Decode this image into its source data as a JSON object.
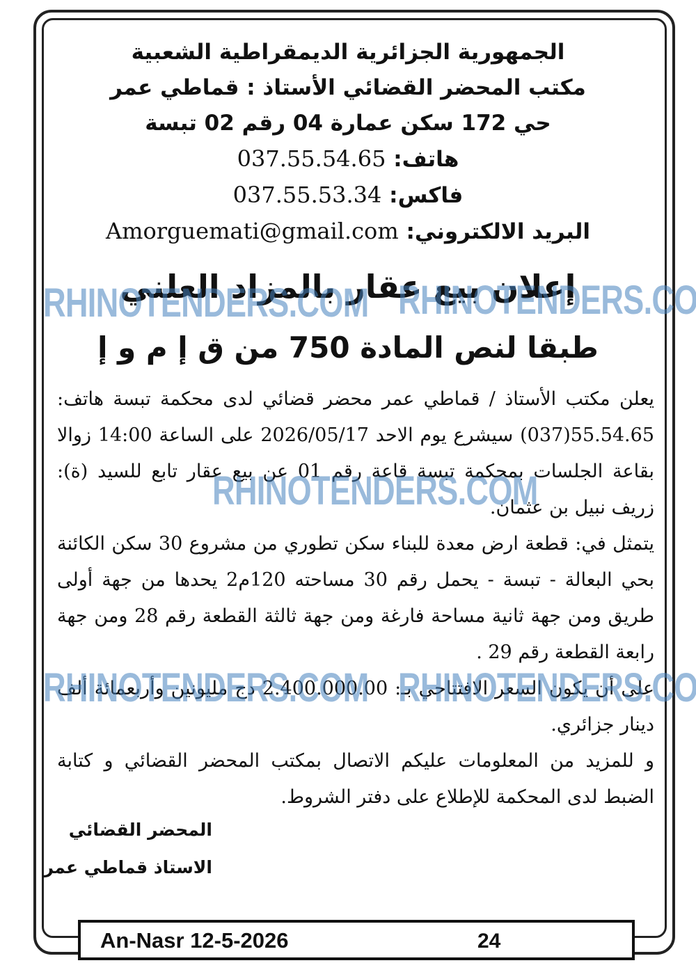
{
  "header": {
    "line1": "الجمهورية الجزائرية الديمقراطية الشعبية",
    "line2": "مكتب المحضر القضائي الأستاذ : قماطي عمر",
    "line3": "حي 172 سكن عمارة 04 رقم 02 تبسة",
    "phone_label": "هاتف:",
    "phone_value": "037.55.54.65",
    "fax_label": "فاكس:",
    "fax_value": "037.55.53.34",
    "email_label": "البريد الالكتروني:",
    "email_value": "Amorguemati@gmail.com"
  },
  "title": {
    "main": "إعلان بيع عقار بالمزاد العلني",
    "sub": "طبقا لنص المادة 750 من ق إ م و إ"
  },
  "body": {
    "p1": "يعلن مكتب الأستاذ / قماطي عمر محضر قضائي لدى محكمة تبسة هاتف: 55.54.65(037) سيشرع يوم الاحد 2026/05/17 على الساعة 14:00 زوالا بقاعة الجلسات بمحكمة تبسة قاعة رقم 01 عن بيع عقار تابع للسيد (ة): زريف نبيل بن عثمان.",
    "p2": "يتمثل في: قطعة ارض معدة للبناء سكن تطوري من مشروع 30 سكن الكائنة بحي البعالة - تبسة - يحمل رقم 30 مساحته 120م2 يحدها من جهة أولى طريق ومن جهة ثانية مساحة فارغة ومن جهة ثالثة القطعة رقم 28 ومن جهة رابعة القطعة رقم 29 .",
    "p3": "على أن يكون السعر الافتتاحي بـ: 2.400.000.00 دج مليونين وأربعمائة ألف دينار جزائري.",
    "p4": "و للمزيد من المعلومات عليكم الاتصال بمكتب المحضر القضائي و كتابة الضبط لدى المحكمة للإطلاع على دفتر الشروط."
  },
  "signature": {
    "line1": "المحضر القضائي",
    "line2": "الاستاذ قماطي عمر"
  },
  "footer": {
    "publication": "An-Nasr 12-5-2026",
    "page": "24"
  },
  "watermark": {
    "text": "RHINOTENDERS.COM",
    "color": "#4682be"
  }
}
